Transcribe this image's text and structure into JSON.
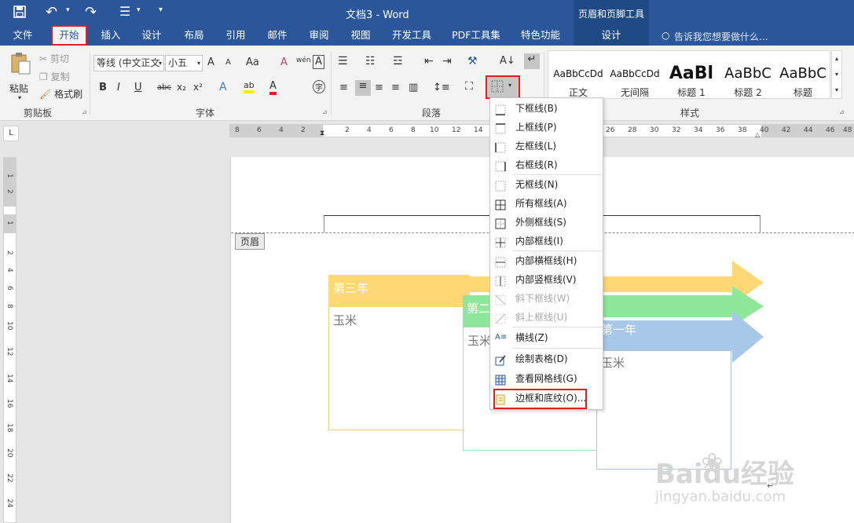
{
  "title_bar": {
    "doc_title": "文档3 - Word",
    "context_tool_title": "页眉和页脚工具",
    "qat_more": "▾"
  },
  "tabs": [
    {
      "label": "文件"
    },
    {
      "label": "开始"
    },
    {
      "label": "插入"
    },
    {
      "label": "设计"
    },
    {
      "label": "布局"
    },
    {
      "label": "引用"
    },
    {
      "label": "邮件"
    },
    {
      "label": "审阅"
    },
    {
      "label": "视图"
    },
    {
      "label": "开发工具"
    },
    {
      "label": "PDF工具集"
    },
    {
      "label": "特色功能"
    },
    {
      "label": "设计"
    }
  ],
  "tell_me": "告诉我您想要做什么...",
  "clipboard": {
    "paste": "粘贴",
    "cut": "剪切",
    "copy": "复制",
    "format_painter": "格式刷",
    "group": "剪贴板"
  },
  "font": {
    "font_name": "等线 (中文正文",
    "font_size": "小五",
    "grow": "A",
    "shrink": "A",
    "case": "Aa",
    "clear_format": "A",
    "phonetic": "wén",
    "border_char": "A",
    "bold": "B",
    "italic": "I",
    "underline": "U",
    "strike": "abc",
    "subscript": "x₂",
    "superscript": "x²",
    "effects": "A",
    "highlight": "ab",
    "font_color": "A",
    "enclose": "字",
    "group": "字体"
  },
  "paragraph": {
    "group": "段落"
  },
  "styles": {
    "group": "样式",
    "items": [
      {
        "sample": "AaBbCcDd",
        "name": "正文"
      },
      {
        "sample": "AaBbCcDd",
        "name": "无间隔"
      },
      {
        "sample": "AaBl",
        "name": "标题 1"
      },
      {
        "sample": "AaBbC",
        "name": "标题 2"
      },
      {
        "sample": "AaBbC",
        "name": "标题"
      }
    ]
  },
  "ruler": {
    "horizontal": [
      "8",
      "6",
      "4",
      "2",
      "2",
      "4",
      "6",
      "8",
      "10",
      "12",
      "14",
      "26",
      "28",
      "30",
      "32",
      "34",
      "36",
      "38",
      "40",
      "42",
      "44",
      "46",
      "48"
    ],
    "vertical": [
      "1",
      "2",
      "1",
      "2",
      "4",
      "6",
      "8",
      "10",
      "12",
      "14",
      "16",
      "18",
      "20",
      "22",
      "24"
    ]
  },
  "document": {
    "header_tag": "页眉",
    "arrows": [
      {
        "title": "第三年",
        "body": "玉米",
        "color": "#ffd876",
        "border": "#f5d67a"
      },
      {
        "title": "第二年",
        "body": "玉米",
        "color": "#8fe89a",
        "border": "#a8ddb0"
      },
      {
        "title": "第一年",
        "body": "玉米",
        "color": "#a8c8ea",
        "border": "#a9c6de"
      }
    ],
    "return_mark": "↵"
  },
  "border_menu": {
    "items": [
      {
        "label": "下框线(B)",
        "enabled": true
      },
      {
        "label": "上框线(P)",
        "enabled": true
      },
      {
        "label": "左框线(L)",
        "enabled": true
      },
      {
        "label": "右框线(R)",
        "enabled": true
      },
      {
        "label": "无框线(N)",
        "enabled": true
      },
      {
        "label": "所有框线(A)",
        "enabled": true
      },
      {
        "label": "外侧框线(S)",
        "enabled": true
      },
      {
        "label": "内部框线(I)",
        "enabled": true
      },
      {
        "label": "内部横框线(H)",
        "enabled": true
      },
      {
        "label": "内部竖框线(V)",
        "enabled": true
      },
      {
        "label": "斜下框线(W)",
        "enabled": false
      },
      {
        "label": "斜上框线(U)",
        "enabled": false
      },
      {
        "label": "横线(Z)",
        "enabled": true
      },
      {
        "label": "绘制表格(D)",
        "enabled": true
      },
      {
        "label": "查看网格线(G)",
        "enabled": true
      },
      {
        "label": "边框和底纹(O)...",
        "enabled": true
      }
    ]
  },
  "watermark": {
    "brand": "Baidu经验",
    "url": "jingyan.baidu.com"
  },
  "colors": {
    "accent": "#2b579a",
    "highlight_red": "#e02020"
  }
}
